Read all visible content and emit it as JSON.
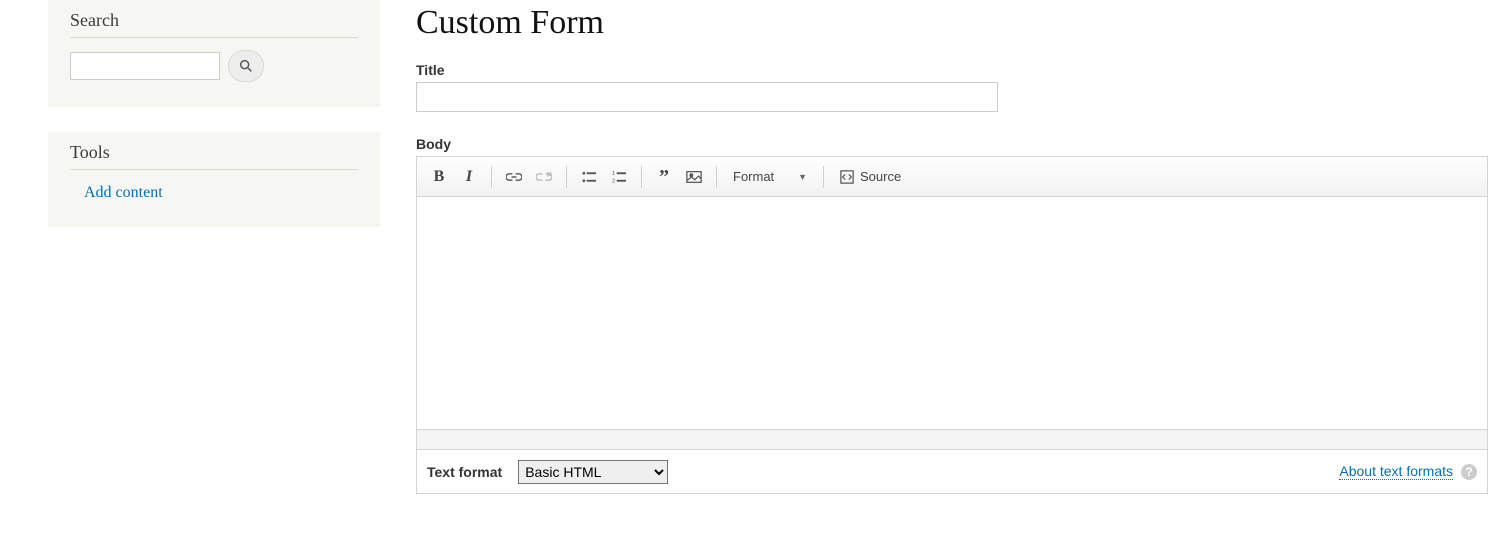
{
  "sidebar": {
    "search_block": {
      "title": "Search",
      "input_value": "",
      "input_placeholder": ""
    },
    "tools_block": {
      "title": "Tools",
      "links": [
        {
          "label": "Add content"
        }
      ]
    }
  },
  "main": {
    "page_title": "Custom Form",
    "fields": {
      "title": {
        "label": "Title",
        "value": ""
      },
      "body": {
        "label": "Body"
      }
    },
    "editor": {
      "format_dropdown_label": "Format",
      "source_label": "Source"
    },
    "text_format": {
      "label": "Text format",
      "selected": "Basic HTML",
      "options": [
        "Basic HTML"
      ],
      "about_link_label": "About text formats",
      "help_symbol": "?"
    }
  }
}
